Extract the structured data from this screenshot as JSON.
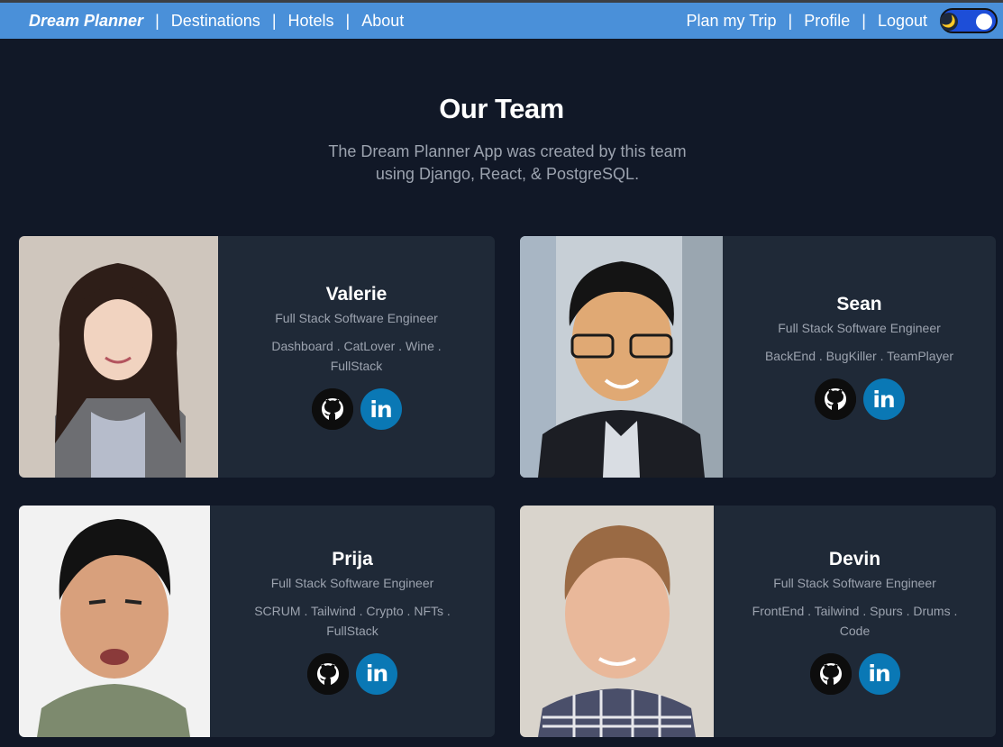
{
  "nav": {
    "brand": "Dream Planner",
    "left_links": [
      "Destinations",
      "Hotels",
      "About"
    ],
    "right_links": [
      "Plan my Trip",
      "Profile",
      "Logout"
    ],
    "separator": "|",
    "theme_toggle": {
      "state": "dark",
      "icon": "moon-icon",
      "moon_glyph": "🌙"
    }
  },
  "hero": {
    "title": "Our Team",
    "subtitle_line1": "The Dream Planner App was created by this team",
    "subtitle_line2": "using Django, React, & PostgreSQL."
  },
  "team": [
    {
      "name": "Valerie",
      "role": "Full Stack Software Engineer",
      "tags": "Dashboard . CatLover . Wine . FullStack",
      "linkedin": "in"
    },
    {
      "name": "Sean",
      "role": "Full Stack Software Engineer",
      "tags": "BackEnd . BugKiller . TeamPlayer",
      "linkedin": "in"
    },
    {
      "name": "Prija",
      "role": "Full Stack Software Engineer",
      "tags": "SCRUM . Tailwind . Crypto . NFTs . FullStack",
      "linkedin": "in"
    },
    {
      "name": "Devin",
      "role": "Full Stack Software Engineer",
      "tags": "FrontEnd . Tailwind . Spurs . Drums . Code",
      "linkedin": "in"
    }
  ],
  "colors": {
    "nav_bg": "#4a90d9",
    "page_bg": "#111827",
    "card_bg": "#1f2937",
    "linkedin_blue": "#0a78b5"
  }
}
